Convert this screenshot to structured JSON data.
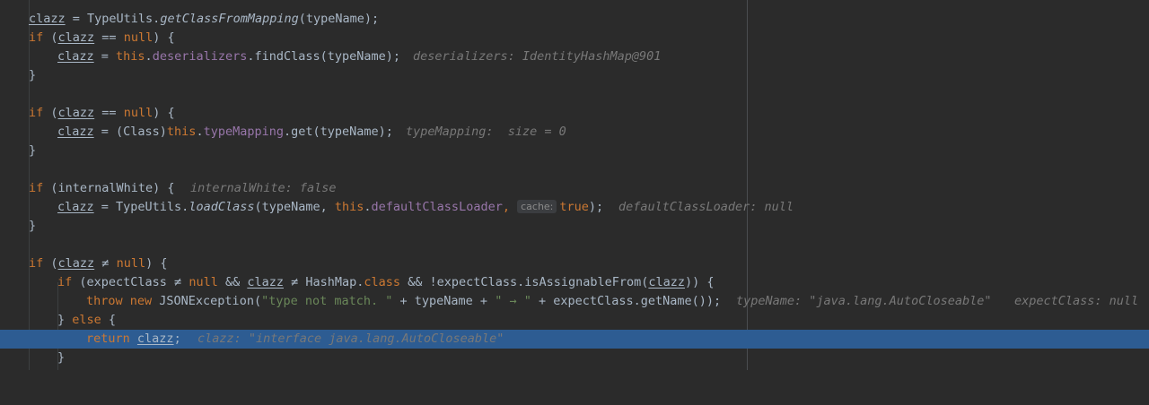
{
  "editor": {
    "line1": {
      "var": "clazz",
      "eq": " = TypeUtils.",
      "method": "getClassFromMapping",
      "args": "(typeName);"
    },
    "line2": {
      "kw": "if",
      "open": " (",
      "var": "clazz",
      "op": " == ",
      "null": "null",
      "close": ") {"
    },
    "line3": {
      "var": "clazz",
      "eq": " = ",
      "this": "this",
      "dot": ".",
      "field": "deserializers",
      "call": ".findClass(typeName);",
      "hint": "deserializers: IdentityHashMap@901"
    },
    "line4": {
      "text": "}"
    },
    "line6": {
      "kw": "if",
      "open": " (",
      "var": "clazz",
      "op": " == ",
      "null": "null",
      "close": ") {"
    },
    "line7": {
      "var": "clazz",
      "eq": " = (Class)",
      "this": "this",
      "dot": ".",
      "field": "typeMapping",
      "call": ".get(typeName);",
      "hint": "typeMapping:  size = 0"
    },
    "line8": {
      "text": "}"
    },
    "line10": {
      "kw": "if",
      "rest": " (internalWhite) {",
      "hint": "internalWhite: false"
    },
    "line11": {
      "var": "clazz",
      "eq": " = TypeUtils.",
      "method": "loadClass",
      "args": "(typeName, ",
      "this": "this",
      "dot": ".",
      "field": "defaultClassLoader",
      "comma": ", ",
      "chip": "cache:",
      "true": "true",
      "end": ");",
      "hint": "defaultClassLoader: null"
    },
    "line12": {
      "text": "}"
    },
    "line14": {
      "kw": "if",
      "open": " (",
      "var": "clazz",
      "op": " ≠ ",
      "null": "null",
      "close": ") {"
    },
    "line15": {
      "kw": "if",
      "p1": " (expectClass ≠ ",
      "null": "null",
      "p2": " && ",
      "var": "clazz",
      "p3": " ≠ HashMap.",
      "class": "class",
      "p4": " && !expectClass.isAssignableFrom(",
      "var2": "clazz",
      "p5": ")) {"
    },
    "line16": {
      "throw": "throw",
      "new": " new",
      "p1": " JSONException(",
      "s1": "\"type not match. \"",
      "p2": " + typeName + ",
      "s2": "\" → \"",
      "p3": " + expectClass.getName());",
      "hint1": "typeName: \"java.lang.AutoCloseable\"",
      "hint2": "expectClass: null"
    },
    "line17": {
      "p1": "} ",
      "else": "else",
      "p2": " {"
    },
    "line18": {
      "kw": "return",
      "var": "clazz",
      "end": ";",
      "hint": "clazz: \"interface java.lang.AutoCloseable\""
    },
    "line19": {
      "text": "}"
    }
  }
}
